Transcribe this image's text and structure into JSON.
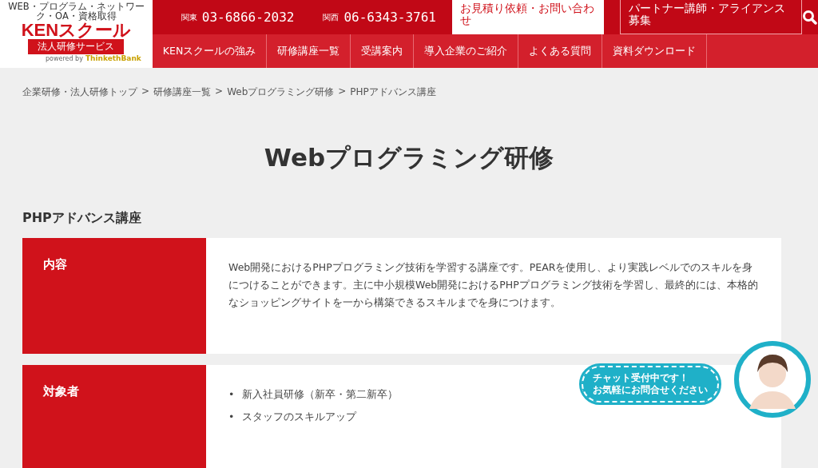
{
  "logo": {
    "tagline": "WEB・プログラム・ネットワーク・OA・資格取得",
    "brand": "KENスクール",
    "service": "法人研修サービス",
    "powered": "powered by",
    "partner": "ThinkethBank"
  },
  "phones": [
    {
      "region": "関東",
      "number": "03-6866-2032"
    },
    {
      "region": "関西",
      "number": "06-6343-3761"
    }
  ],
  "header_buttons": [
    {
      "label": "お見積り依頼・お問い合わせ",
      "kind": "light"
    },
    {
      "label": "パートナー講師・アライアンス募集",
      "kind": "outline"
    }
  ],
  "nav": [
    "KENスクールの強み",
    "研修講座一覧",
    "受講案内",
    "導入企業のご紹介",
    "よくある質問",
    "資料ダウンロード"
  ],
  "breadcrumb": [
    "企業研修・法人研修トップ",
    "研修講座一覧",
    "Webプログラミング研修",
    "PHPアドバンス講座"
  ],
  "breadcrumb_separator": ">",
  "title": "Webプログラミング研修",
  "section_title": "PHPアドバンス講座",
  "rows": [
    {
      "label": "内容",
      "kind": "text",
      "text": "Web開発におけるPHPプログラミング技術を学習する講座です。PEARを使用し、より実践レベルでのスキルを身につけることができます。主に中小規模Web開発におけるPHPプログラミング技術を学習し、最終的には、本格的なショッピングサイトを一から構築できるスキルまでを身につけます。"
    },
    {
      "label": "対象者",
      "kind": "list",
      "bullet": "•",
      "items": [
        "新入社員研修（新卒・第二新卒）",
        "スタッフのスキルアップ"
      ]
    }
  ],
  "chat": {
    "lines": [
      "チャット受付中です！",
      "お気軽にお問合せください"
    ]
  }
}
